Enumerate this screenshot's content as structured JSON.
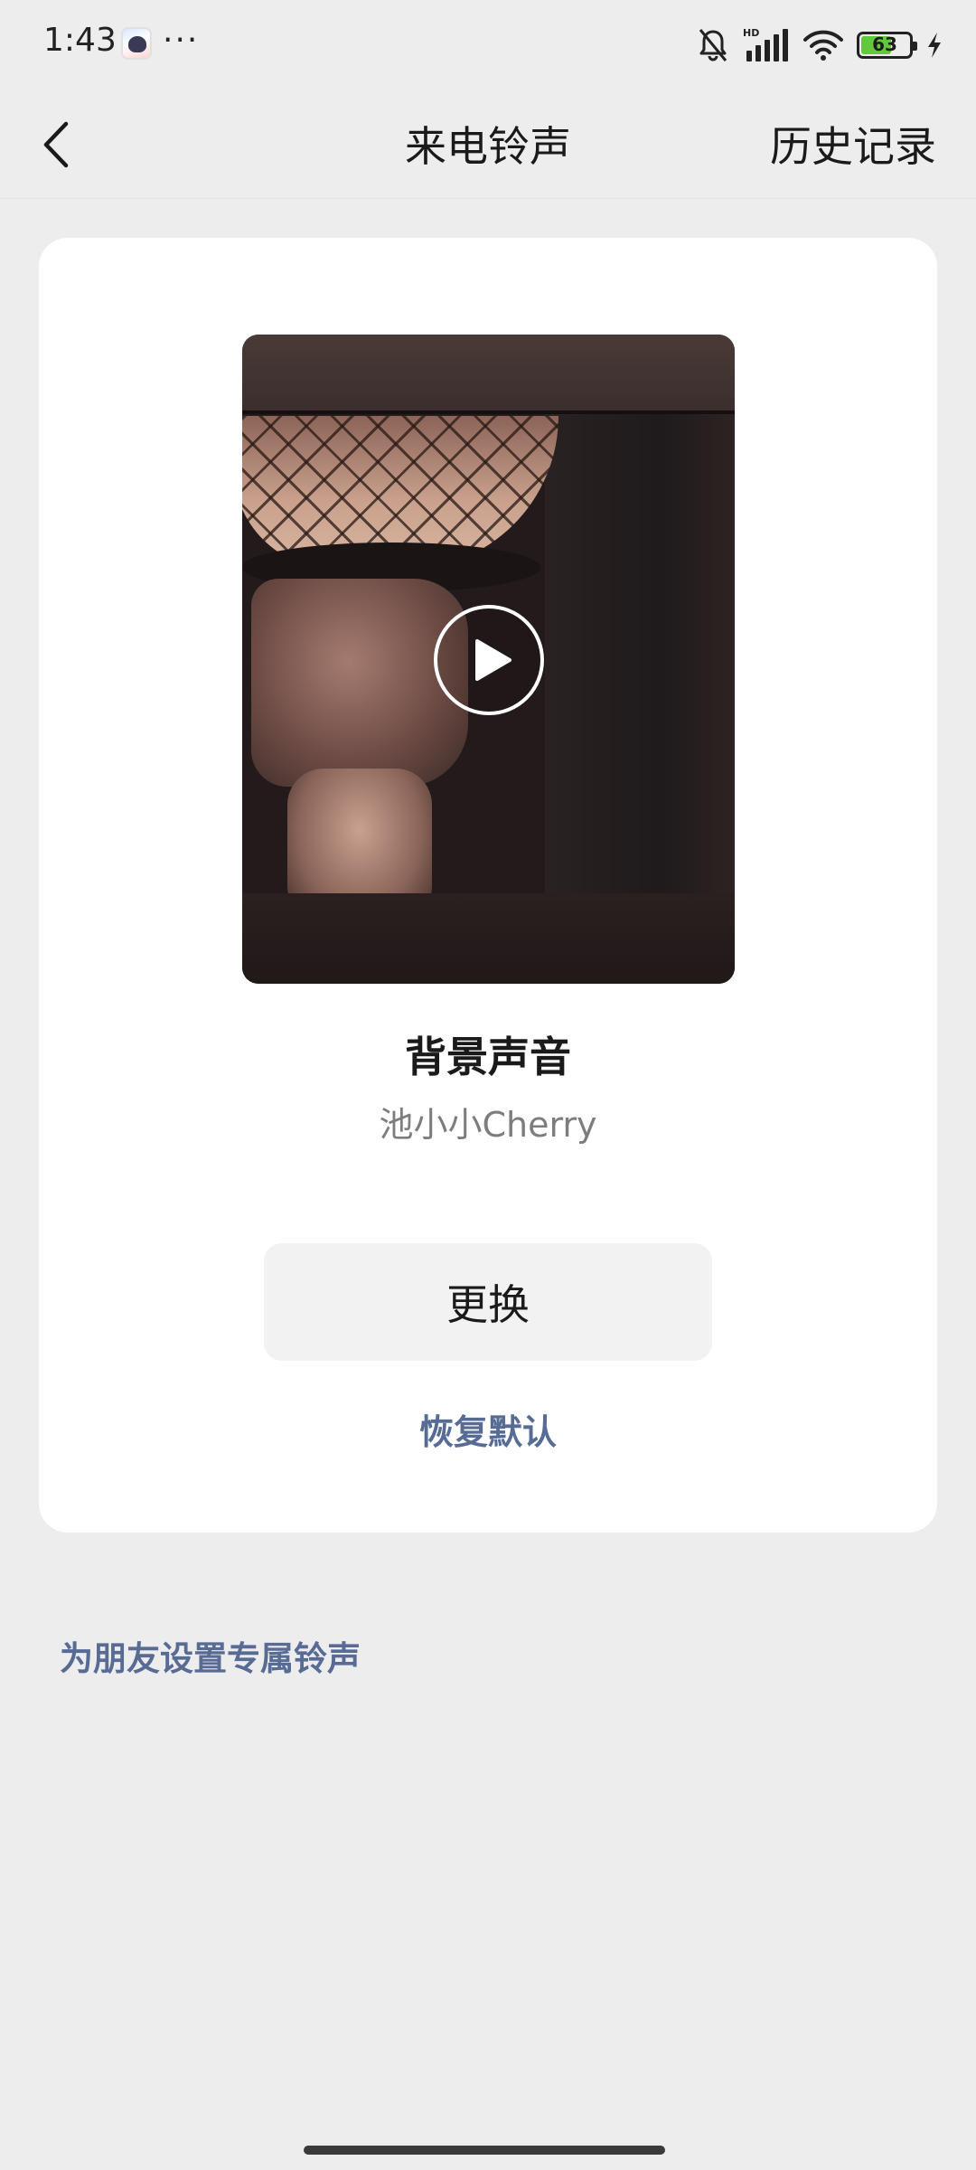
{
  "status_bar": {
    "time": "1:43",
    "more": "···",
    "network_label": "HD",
    "battery_level": "63",
    "battery_fraction": 0.63,
    "battery_color": "#61c93b",
    "icons": [
      "app-notification-icon",
      "bell-muted-icon",
      "signal-icon",
      "wifi-icon",
      "battery-icon",
      "charging-icon"
    ]
  },
  "nav": {
    "back_icon": "chevron-left-icon",
    "title": "来电铃声",
    "history_label": "历史记录"
  },
  "ringtone": {
    "play_icon": "play-icon",
    "title": "背景声音",
    "artist": "池小小Cherry",
    "change_label": "更换",
    "restore_label": "恢复默认"
  },
  "friend_ringtone_label": "为朋友设置专属铃声",
  "colors": {
    "background": "#ededed",
    "card": "#ffffff",
    "link": "#576b95",
    "button": "#f2f2f2"
  }
}
